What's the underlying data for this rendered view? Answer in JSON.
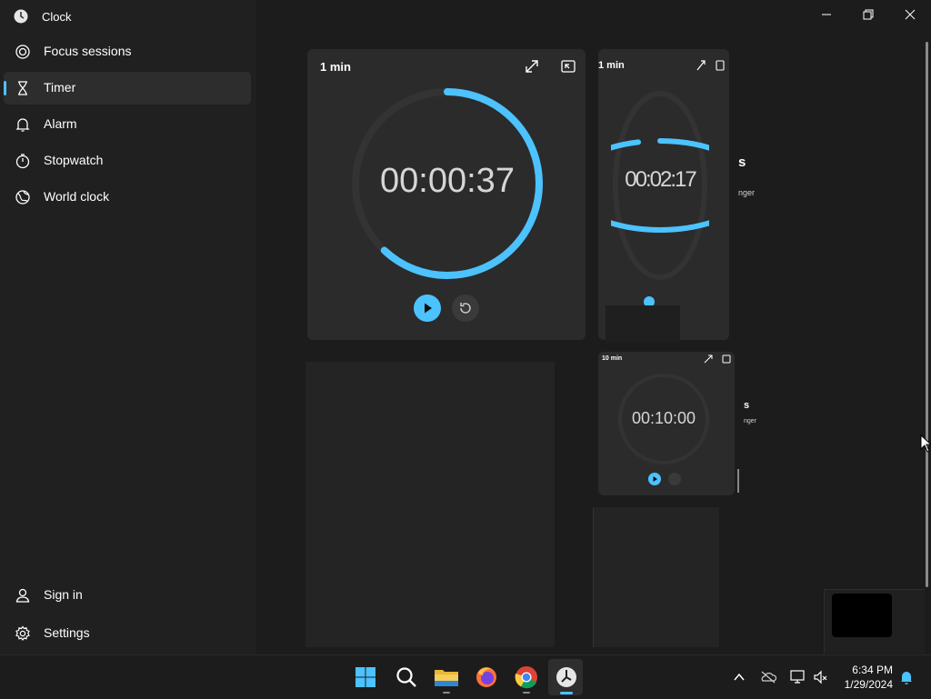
{
  "app": {
    "title": "Clock"
  },
  "nav": {
    "items": [
      {
        "label": "Focus sessions",
        "icon": "focus-icon"
      },
      {
        "label": "Timer",
        "icon": "hourglass-icon",
        "active": true
      },
      {
        "label": "Alarm",
        "icon": "bell-icon"
      },
      {
        "label": "Stopwatch",
        "icon": "stopwatch-icon"
      },
      {
        "label": "World clock",
        "icon": "globe-icon"
      }
    ],
    "footer": [
      {
        "label": "Sign in",
        "icon": "person-icon"
      },
      {
        "label": "Settings",
        "icon": "gear-icon"
      }
    ]
  },
  "timers": [
    {
      "title": "1 min",
      "time": "00:00:37",
      "progress": 0.62
    },
    {
      "title": "1 min",
      "time": "00:02:17",
      "progress": 0.95
    },
    {
      "title": "10 min",
      "time": "00:10:00",
      "progress": 0
    }
  ],
  "side_fragments": [
    "s",
    "nger",
    "s",
    "nger"
  ],
  "taskbar": {
    "time": "6:34 PM",
    "date": "1/29/2024",
    "apps": [
      "windows-start-icon",
      "search-icon",
      "file-explorer-icon",
      "firefox-icon",
      "chrome-icon",
      "clock-app-icon"
    ]
  },
  "colors": {
    "accent": "#4cc2ff",
    "track": "#333333",
    "background": "#202020"
  }
}
